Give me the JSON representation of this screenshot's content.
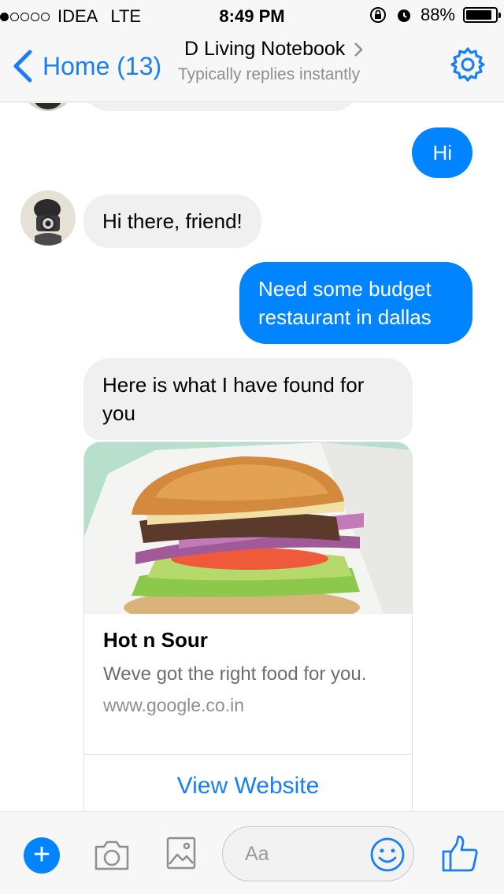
{
  "status_bar": {
    "signal_dots": [
      true,
      false,
      false,
      false,
      false
    ],
    "carrier": "IDEA",
    "network": "LTE",
    "time": "8:49 PM",
    "battery": "88%",
    "battery_level": 0.88
  },
  "header": {
    "back_label": "Home (13)",
    "title": "D Living Notebook",
    "subtitle": "Typically replies instantly"
  },
  "messages": [
    {
      "from": "me",
      "text": "Hi"
    },
    {
      "from": "bot",
      "text": "Hi there, friend!"
    },
    {
      "from": "me",
      "text": "Need some budget restaurant in dallas"
    },
    {
      "from": "bot",
      "text": "Here is what I have found for you"
    }
  ],
  "card": {
    "title": "Hot n Sour",
    "subtitle": "Weve got the right food for you.",
    "url": "www.google.co.in",
    "action_label": "View Website"
  },
  "composer": {
    "placeholder": "Aa"
  },
  "colors": {
    "accent": "#0084ff",
    "link": "#1a7ef5",
    "incoming_bubble": "#f0f0f0"
  },
  "icons": [
    "back-chevron-icon",
    "chevron-right-icon",
    "gear-icon",
    "plus-icon",
    "camera-icon",
    "image-icon",
    "emoji-icon",
    "thumbs-up-icon",
    "lock-rotation-icon",
    "alarm-icon",
    "battery-icon"
  ]
}
